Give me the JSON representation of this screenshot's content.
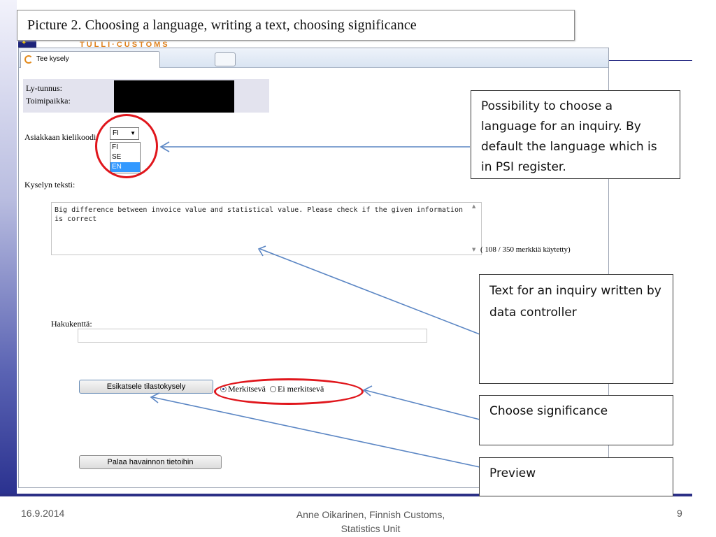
{
  "slide": {
    "caption": "Picture 2. Choosing a language, writing a text, choosing significance",
    "logo_text": "TULLI·CUSTOMS",
    "footer": {
      "date": "16.9.2014",
      "author_line1": "Anne Oikarinen, Finnish Customs,",
      "author_line2": "Statistics Unit",
      "page": "9"
    }
  },
  "window": {
    "tab_title": "Tee kysely"
  },
  "form": {
    "ly_label": "Ly-tunnus:",
    "office_label": "Toimipaikka:",
    "language_label": "Asiakkaan kielikoodi:",
    "language_selected": "FI",
    "language_options": [
      "FI",
      "SE",
      "EN"
    ],
    "language_highlighted": "EN",
    "text_label": "Kyselyn teksti:",
    "text_value": "Big difference between invoice value and statistical value. Please check if the given information is correct",
    "char_counter": "( 108 / 350 merkkiä käytetty)",
    "search_label": "Hakukenttä:",
    "search_value": "",
    "preview_button": "Esikatsele tilastokysely",
    "significance": {
      "selected": "Merkitsevä",
      "options": [
        "Merkitsevä",
        "Ei merkitsevä"
      ]
    },
    "back_button": "Palaa havainnon tietoihin"
  },
  "annotations": {
    "language": "Possibility to choose a language for an inquiry. By default the language which is in PSI register.",
    "text": "Text for an inquiry written by data controller",
    "significance": "Choose significance",
    "preview": "Preview"
  },
  "colors": {
    "highlight_ellipse": "#e0161c",
    "arrow": "#5b86c4",
    "slide_navy": "#2b2f86",
    "logo_orange": "#e0811c"
  }
}
